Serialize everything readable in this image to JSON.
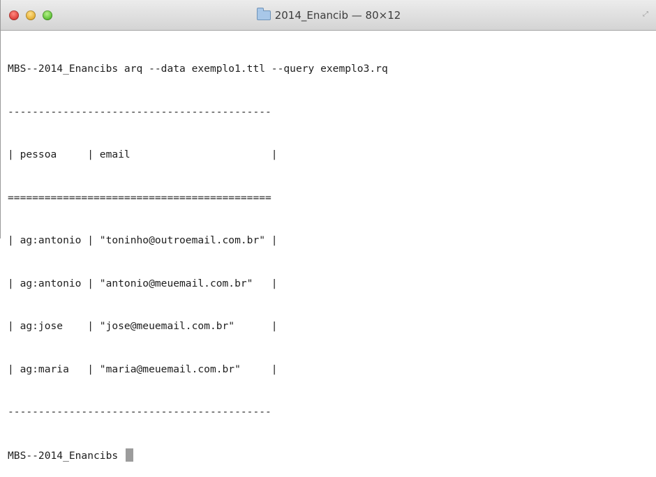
{
  "window": {
    "title": "2014_Enancib — 80×12",
    "icon": "folder-icon",
    "colors": {
      "titlebar": "#d9d9d9",
      "text": "#1e1e1e",
      "cursor": "#9c9c9c"
    }
  },
  "terminal": {
    "command_line": "MBS--2014_Enancibs arq --data exemplo1.ttl --query exemplo3.rq",
    "separator_top": "-------------------------------------------",
    "header_row": "| pessoa     | email                       |",
    "separator_header": "===========================================",
    "rows": [
      "| ag:antonio | \"toninho@outroemail.com.br\" |",
      "| ag:antonio | \"antonio@meuemail.com.br\"   |",
      "| ag:jose    | \"jose@meuemail.com.br\"      |",
      "| ag:maria   | \"maria@meuemail.com.br\"     |"
    ],
    "separator_bottom": "-------------------------------------------",
    "prompt": "MBS--2014_Enancibs "
  }
}
